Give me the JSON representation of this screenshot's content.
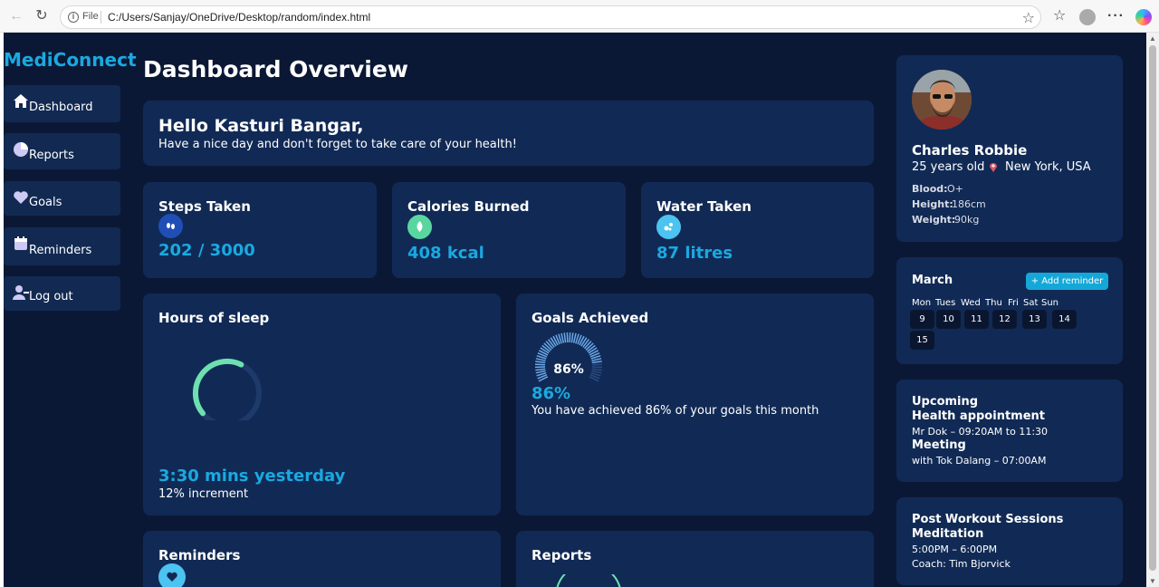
{
  "browser": {
    "file_label": "File",
    "url": "C:/Users/Sanjay/OneDrive/Desktop/random/index.html"
  },
  "brand": "MediConnect",
  "sidebar": {
    "items": [
      {
        "label": "Dashboard",
        "icon": "home-icon"
      },
      {
        "label": "Reports",
        "icon": "pie-chart-icon"
      },
      {
        "label": "Goals",
        "icon": "heart-icon"
      },
      {
        "label": "Reminders",
        "icon": "calendar-icon"
      },
      {
        "label": "Log out",
        "icon": "user-logout-icon"
      }
    ]
  },
  "header": {
    "title": "Dashboard Overview"
  },
  "greeting": {
    "title": "Hello Kasturi Bangar,",
    "subtitle": "Have a nice day and don't forget to take care of your health!"
  },
  "stats": [
    {
      "title": "Steps Taken",
      "value": "202 / 3000",
      "icon": "footsteps-icon",
      "icon_color": "#1f4fb6"
    },
    {
      "title": "Calories Burned",
      "value": "408 kcal",
      "icon": "flame-icon",
      "icon_color": "#59d6a0"
    },
    {
      "title": "Water Taken",
      "value": "87 litres",
      "icon": "water-drops-icon",
      "icon_color": "#4cc3f0"
    }
  ],
  "sleep": {
    "title": "Hours of sleep",
    "value": "3:30 mins yesterday",
    "note": "12% increment",
    "progress": 0.72
  },
  "goals": {
    "title": "Goals Achieved",
    "gauge_label": "86%",
    "value": "86%",
    "description": "You have achieved 86% of your goals this month",
    "progress": 0.86
  },
  "reminders_card": {
    "title": "Reminders",
    "icon": "head-heart-icon"
  },
  "reports_card": {
    "title": "Reports"
  },
  "profile": {
    "name": "Charles Robbie",
    "age_location_prefix": "25 years old",
    "location_icon": "pin-icon",
    "location": "New York, USA",
    "blood_label": "Blood:",
    "blood": "O+",
    "height_label": "Height:",
    "height": "186cm",
    "weight_label": "Weight:",
    "weight": "90kg",
    "avatar": "avatar"
  },
  "calendar": {
    "month": "March",
    "add_label": "+ Add reminder",
    "day_names": [
      "Mon",
      "Tues",
      "Wed",
      "Thu",
      "Fri",
      "Sat",
      "Sun"
    ],
    "dates": [
      "9",
      "10",
      "11",
      "12",
      "13",
      "14",
      "15"
    ]
  },
  "upcoming": {
    "title": "Upcoming",
    "item1_title": "Health appointment",
    "item1_detail": "Mr Dok – 09:20AM to 11:30",
    "item2_title": "Meeting",
    "item2_detail": "with Tok Dalang – 07:00AM"
  },
  "session": {
    "title": "Post Workout Sessions",
    "subtitle": "Meditation",
    "time": "5:00PM – 6:00PM",
    "coach": "Coach: Tim Bjorvick"
  },
  "colors": {
    "accent": "#1aa9e0",
    "card": "#112a55",
    "background": "#0b1835",
    "button": "#14a8d8"
  }
}
